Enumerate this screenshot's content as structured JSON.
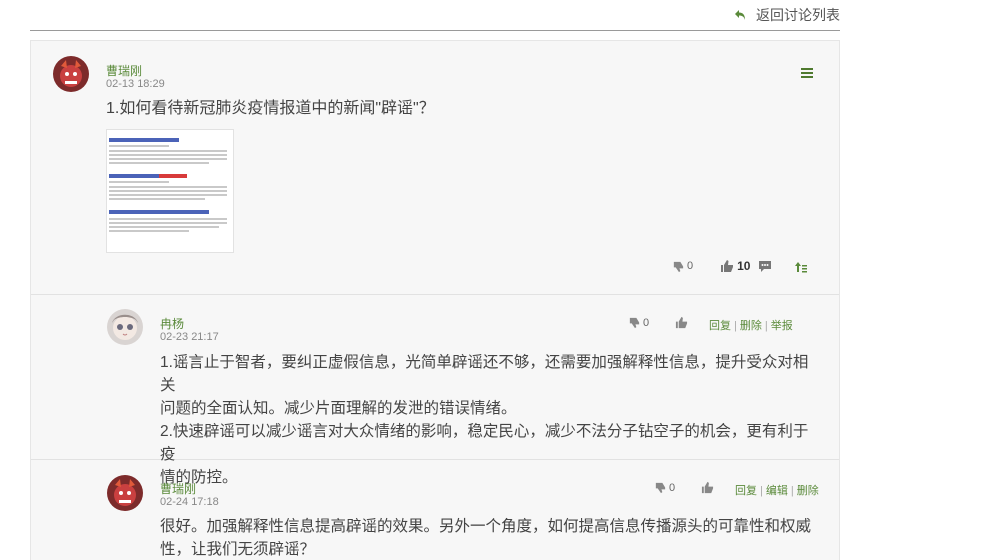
{
  "header": {
    "back_label": "返回讨论列表"
  },
  "main_post": {
    "author": "曹瑞刚",
    "time": "02-13 18:29",
    "text": "1.如何看待新冠肺炎疫情报道中的新闻\"辟谣\"？",
    "dislike_count": "0",
    "like_count": "10"
  },
  "replies": [
    {
      "author": "冉杨",
      "time": "02-23 21:17",
      "text": "1.谣言止于智者，要纠正虚假信息，光简单辟谣还不够，还需要加强解释性信息，提升受众对相关问题的全面认知。减少片面理解的发泄的错误情绪。2.快速辟谣可以减少谣言对大众情绪的影响，稳定民心，减少不法分子钻空子的机会，更有利于疫情的防控。",
      "lines": [
        "1.谣言止于智者，要纠正虚假信息，光简单辟谣还不够，还需要加强解释性信息，提升受众对相关",
        "问题的全面认知。减少片面理解的发泄的错误情绪。",
        "2.快速辟谣可以减少谣言对大众情绪的影响，稳定民心，减少不法分子钻空子的机会，更有利于疫",
        "情的防控。"
      ],
      "dislike_count": "0",
      "links": [
        "回复",
        "删除",
        "举报"
      ]
    },
    {
      "author": "曹瑞刚",
      "time": "02-24 17:18",
      "lines": [
        "很好。加强解释性信息提高辟谣的效果。另外一个角度，如何提高信息传播源头的可靠性和权威",
        "性，让我们无须辟谣？"
      ],
      "dislike_count": "0",
      "links": [
        "回复",
        "编辑",
        "删除"
      ]
    }
  ],
  "colors": {
    "accent_green": "#5a8a3a",
    "panel_bg": "#f7f7f7"
  }
}
